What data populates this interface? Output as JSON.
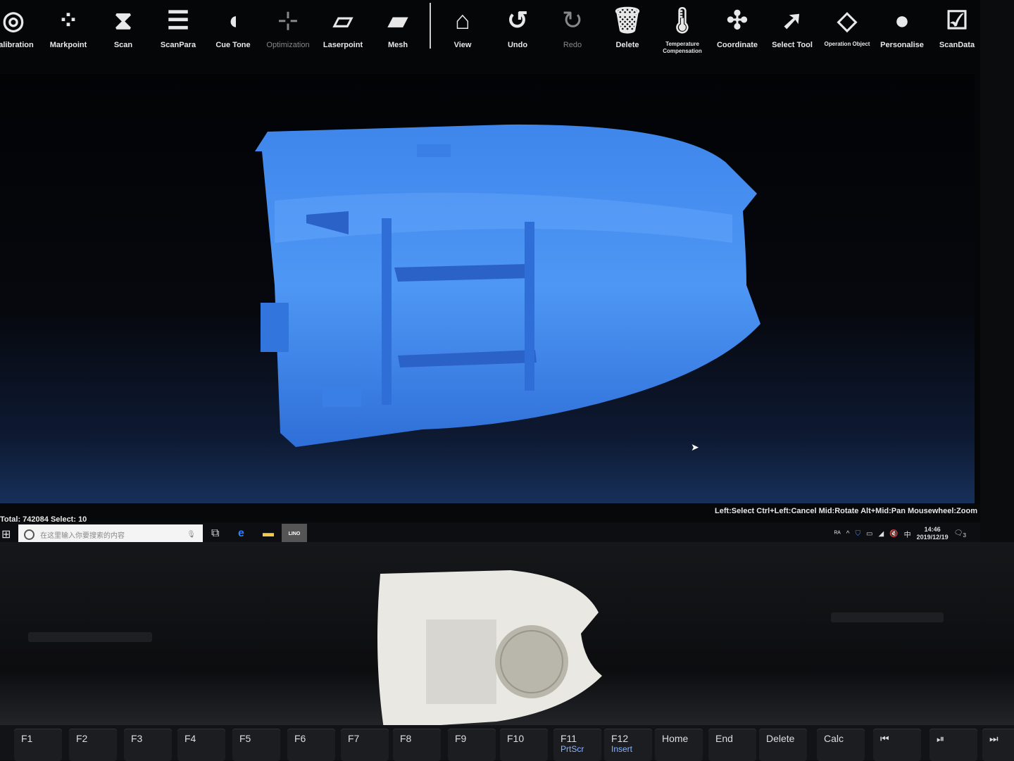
{
  "toolbar": {
    "items": [
      {
        "label": "Calibration",
        "icon": "calibration-icon",
        "glyph": "◎"
      },
      {
        "label": "Markpoint",
        "icon": "markpoint-icon",
        "glyph": "⁘"
      },
      {
        "label": "Scan",
        "icon": "scan-icon",
        "glyph": "⧗"
      },
      {
        "label": "ScanPara",
        "icon": "sliders-icon",
        "glyph": "☰"
      },
      {
        "label": "Cue Tone",
        "icon": "speaker-icon",
        "glyph": "◖"
      },
      {
        "label": "Optimization",
        "icon": "optimization-icon",
        "glyph": "⊹"
      },
      {
        "label": "Laserpoint",
        "icon": "laserpoint-icon",
        "glyph": "▱"
      },
      {
        "label": "Mesh",
        "icon": "mesh-icon",
        "glyph": "▰"
      },
      {
        "label": "View",
        "icon": "house-icon",
        "glyph": "⌂"
      },
      {
        "label": "Undo",
        "icon": "undo-icon",
        "glyph": "↺"
      },
      {
        "label": "Redo",
        "icon": "redo-icon",
        "glyph": "↻"
      },
      {
        "label": "Delete",
        "icon": "trash-icon",
        "glyph": "🗑"
      },
      {
        "label": "Temperature Compensation",
        "icon": "thermometer-icon",
        "glyph": "🌡"
      },
      {
        "label": "Coordinate",
        "icon": "coordinate-icon",
        "glyph": "✣"
      },
      {
        "label": "Select Tool",
        "icon": "lasso-select-icon",
        "glyph": "➚"
      },
      {
        "label": "Operation Object",
        "icon": "operation-object-icon",
        "glyph": "◇"
      },
      {
        "label": "Personalise",
        "icon": "personalise-icon",
        "glyph": "●"
      },
      {
        "label": "ScanData",
        "icon": "checklist-icon",
        "glyph": "☑"
      }
    ]
  },
  "status": {
    "left": "Total: 742084 Select: 10",
    "right": "Left:Select Ctrl+Left:Cancel Mid:Rotate Alt+Mid:Pan Mousewheel:Zoom"
  },
  "taskbar": {
    "search_placeholder": "在这里输入你要搜索的内容",
    "app_label": "LINO",
    "ime": "中",
    "time": "14:46",
    "date": "2019/12/19",
    "notifications": "3"
  },
  "colors": {
    "model": "#3a7fe6",
    "background": "#050608"
  },
  "keyboard": {
    "keys": [
      {
        "label": "F1"
      },
      {
        "label": "F2"
      },
      {
        "label": "F3"
      },
      {
        "label": "F4"
      },
      {
        "label": "F5"
      },
      {
        "label": "F6"
      },
      {
        "label": "F7"
      },
      {
        "label": "F8"
      },
      {
        "label": "F9"
      },
      {
        "label": "F10"
      },
      {
        "label": "F11",
        "sub": "PrtScr"
      },
      {
        "label": "F12",
        "sub": "Insert"
      },
      {
        "label": "Home"
      },
      {
        "label": "End"
      },
      {
        "label": "Delete"
      },
      {
        "label": "Calc"
      },
      {
        "label": "⏮"
      },
      {
        "label": "⏯"
      },
      {
        "label": "⏭"
      }
    ]
  }
}
